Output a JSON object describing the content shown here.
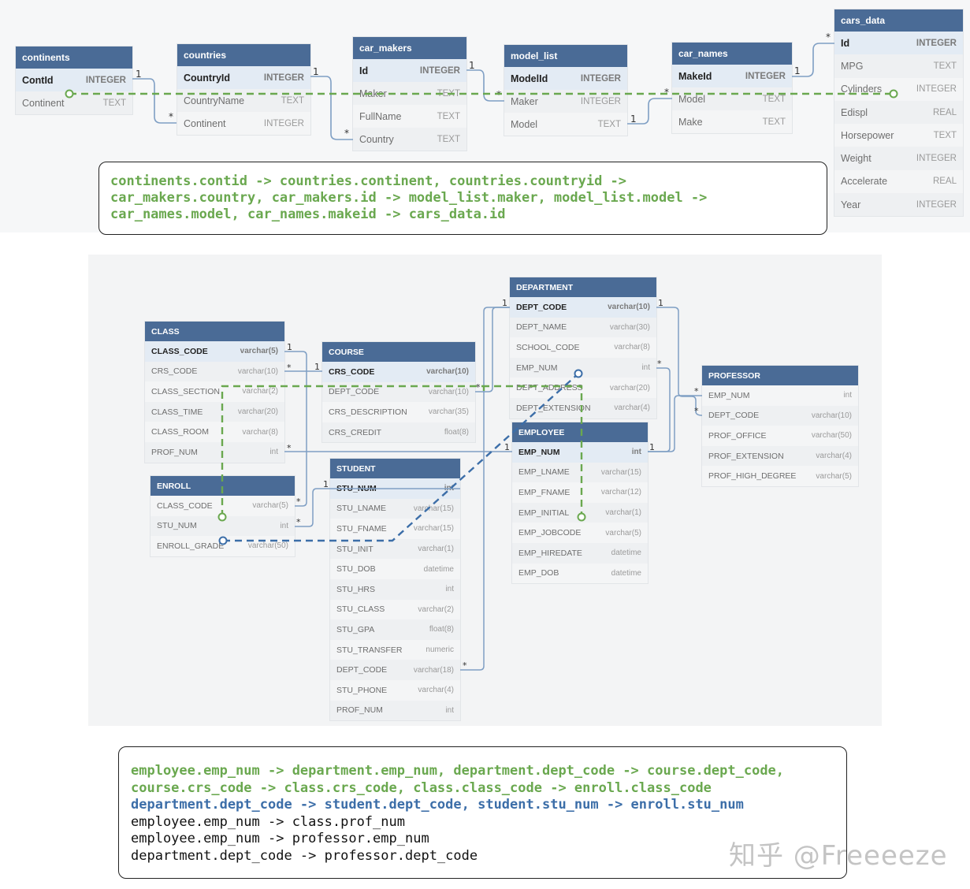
{
  "schema1": {
    "continents": {
      "title": "continents",
      "cols": [
        {
          "name": "ContId",
          "type": "INTEGER",
          "pk": true
        },
        {
          "name": "Continent",
          "type": "TEXT"
        }
      ]
    },
    "countries": {
      "title": "countries",
      "cols": [
        {
          "name": "CountryId",
          "type": "INTEGER",
          "pk": true
        },
        {
          "name": "CountryName",
          "type": "TEXT"
        },
        {
          "name": "Continent",
          "type": "INTEGER"
        }
      ]
    },
    "car_makers": {
      "title": "car_makers",
      "cols": [
        {
          "name": "Id",
          "type": "INTEGER",
          "pk": true
        },
        {
          "name": "Maker",
          "type": "TEXT"
        },
        {
          "name": "FullName",
          "type": "TEXT"
        },
        {
          "name": "Country",
          "type": "TEXT"
        }
      ]
    },
    "model_list": {
      "title": "model_list",
      "cols": [
        {
          "name": "ModelId",
          "type": "INTEGER",
          "pk": true
        },
        {
          "name": "Maker",
          "type": "INTEGER"
        },
        {
          "name": "Model",
          "type": "TEXT"
        }
      ]
    },
    "car_names": {
      "title": "car_names",
      "cols": [
        {
          "name": "MakeId",
          "type": "INTEGER",
          "pk": true
        },
        {
          "name": "Model",
          "type": "TEXT"
        },
        {
          "name": "Make",
          "type": "TEXT"
        }
      ]
    },
    "cars_data": {
      "title": "cars_data",
      "cols": [
        {
          "name": "Id",
          "type": "INTEGER",
          "pk": true
        },
        {
          "name": "MPG",
          "type": "TEXT"
        },
        {
          "name": "Cylinders",
          "type": "INTEGER"
        },
        {
          "name": "Edispl",
          "type": "REAL"
        },
        {
          "name": "Horsepower",
          "type": "TEXT"
        },
        {
          "name": "Weight",
          "type": "INTEGER"
        },
        {
          "name": "Accelerate",
          "type": "REAL"
        },
        {
          "name": "Year",
          "type": "INTEGER"
        }
      ]
    },
    "sql_lines": [
      "continents.contid -> countries.continent, countries.countryid ->",
      "car_makers.country, car_makers.id -> model_list.maker, model_list.model ->",
      "car_names.model, car_names.makeid -> cars_data.id"
    ]
  },
  "schema2": {
    "class": {
      "title": "CLASS",
      "cols": [
        {
          "name": "CLASS_CODE",
          "type": "varchar(5)",
          "pk": true
        },
        {
          "name": "CRS_CODE",
          "type": "varchar(10)"
        },
        {
          "name": "CLASS_SECTION",
          "type": "varchar(2)"
        },
        {
          "name": "CLASS_TIME",
          "type": "varchar(20)"
        },
        {
          "name": "CLASS_ROOM",
          "type": "varchar(8)"
        },
        {
          "name": "PROF_NUM",
          "type": "int"
        }
      ]
    },
    "enroll": {
      "title": "ENROLL",
      "cols": [
        {
          "name": "CLASS_CODE",
          "type": "varchar(5)"
        },
        {
          "name": "STU_NUM",
          "type": "int"
        },
        {
          "name": "ENROLL_GRADE",
          "type": "varchar(50)"
        }
      ]
    },
    "course": {
      "title": "COURSE",
      "cols": [
        {
          "name": "CRS_CODE",
          "type": "varchar(10)",
          "pk": true
        },
        {
          "name": "DEPT_CODE",
          "type": "varchar(10)"
        },
        {
          "name": "CRS_DESCRIPTION",
          "type": "varchar(35)"
        },
        {
          "name": "CRS_CREDIT",
          "type": "float(8)"
        }
      ]
    },
    "student": {
      "title": "STUDENT",
      "cols": [
        {
          "name": "STU_NUM",
          "type": "int",
          "pk": true
        },
        {
          "name": "STU_LNAME",
          "type": "varchar(15)"
        },
        {
          "name": "STU_FNAME",
          "type": "varchar(15)"
        },
        {
          "name": "STU_INIT",
          "type": "varchar(1)"
        },
        {
          "name": "STU_DOB",
          "type": "datetime"
        },
        {
          "name": "STU_HRS",
          "type": "int"
        },
        {
          "name": "STU_CLASS",
          "type": "varchar(2)"
        },
        {
          "name": "STU_GPA",
          "type": "float(8)"
        },
        {
          "name": "STU_TRANSFER",
          "type": "numeric"
        },
        {
          "name": "DEPT_CODE",
          "type": "varchar(18)"
        },
        {
          "name": "STU_PHONE",
          "type": "varchar(4)"
        },
        {
          "name": "PROF_NUM",
          "type": "int"
        }
      ]
    },
    "department": {
      "title": "DEPARTMENT",
      "cols": [
        {
          "name": "DEPT_CODE",
          "type": "varchar(10)",
          "pk": true
        },
        {
          "name": "DEPT_NAME",
          "type": "varchar(30)"
        },
        {
          "name": "SCHOOL_CODE",
          "type": "varchar(8)"
        },
        {
          "name": "EMP_NUM",
          "type": "int"
        },
        {
          "name": "DEPT_ADDRESS",
          "type": "varchar(20)"
        },
        {
          "name": "DEPT_EXTENSION",
          "type": "varchar(4)"
        }
      ]
    },
    "employee": {
      "title": "EMPLOYEE",
      "cols": [
        {
          "name": "EMP_NUM",
          "type": "int",
          "pk": true
        },
        {
          "name": "EMP_LNAME",
          "type": "varchar(15)"
        },
        {
          "name": "EMP_FNAME",
          "type": "varchar(12)"
        },
        {
          "name": "EMP_INITIAL",
          "type": "varchar(1)"
        },
        {
          "name": "EMP_JOBCODE",
          "type": "varchar(5)"
        },
        {
          "name": "EMP_HIREDATE",
          "type": "datetime"
        },
        {
          "name": "EMP_DOB",
          "type": "datetime"
        }
      ]
    },
    "professor": {
      "title": "PROFESSOR",
      "cols": [
        {
          "name": "EMP_NUM",
          "type": "int"
        },
        {
          "name": "DEPT_CODE",
          "type": "varchar(10)"
        },
        {
          "name": "PROF_OFFICE",
          "type": "varchar(50)"
        },
        {
          "name": "PROF_EXTENSION",
          "type": "varchar(4)"
        },
        {
          "name": "PROF_HIGH_DEGREE",
          "type": "varchar(5)"
        }
      ]
    },
    "sql_green": [
      "employee.emp_num -> department.emp_num, department.dept_code -> course.dept_code,",
      "course.crs_code -> class.crs_code, class.class_code -> enroll.class_code"
    ],
    "sql_blue": [
      "department.dept_code -> student.dept_code, student.stu_num -> enroll.stu_num"
    ],
    "sql_black": [
      "employee.emp_num -> class.prof_num",
      "employee.emp_num -> professor.emp_num",
      "department.dept_code -> professor.dept_code"
    ]
  },
  "watermark": "知乎 @Freeeeze",
  "colors": {
    "header": "#4a6b96",
    "green": "#6aa84f",
    "blue": "#3c6ea8",
    "link": "#7f9fc4"
  }
}
